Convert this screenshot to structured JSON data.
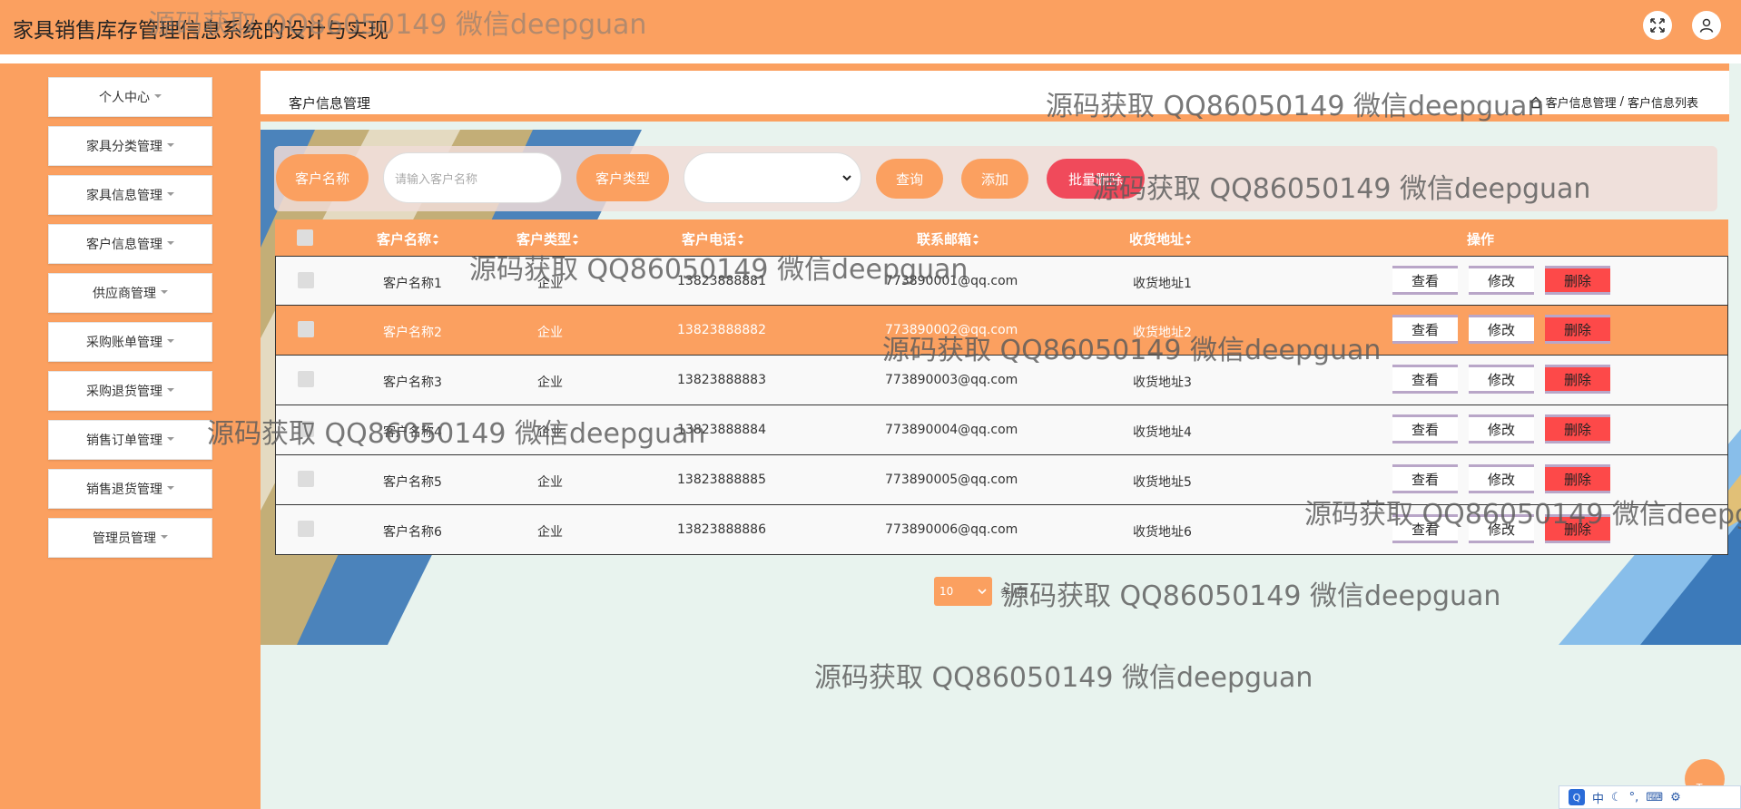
{
  "app": {
    "title": "家具销售库存管理信息系统的设计与实现"
  },
  "sidebar": {
    "items": [
      {
        "label": "个人中心"
      },
      {
        "label": "家具分类管理"
      },
      {
        "label": "家具信息管理"
      },
      {
        "label": "客户信息管理"
      },
      {
        "label": "供应商管理"
      },
      {
        "label": "采购账单管理"
      },
      {
        "label": "采购退货管理"
      },
      {
        "label": "销售订单管理"
      },
      {
        "label": "销售退货管理"
      },
      {
        "label": "管理员管理"
      }
    ]
  },
  "page": {
    "title": "客户信息管理",
    "breadcrumb": [
      "客户信息管理",
      "/",
      "客户信息列表"
    ]
  },
  "search": {
    "name_label": "客户名称",
    "name_placeholder": "请输入客户名称",
    "type_label": "客户类型",
    "type_value": "",
    "query_button": "查询",
    "add_button": "添加",
    "batch_delete_button": "批量删除"
  },
  "table": {
    "columns": [
      "客户名称",
      "客户类型",
      "客户电话",
      "联系邮箱",
      "收货地址",
      "操作"
    ],
    "actions": {
      "view": "查看",
      "edit": "修改",
      "delete": "删除"
    },
    "rows": [
      {
        "name": "客户名称1",
        "type": "企业",
        "phone": "13823888881",
        "email": "773890001@qq.com",
        "address": "收货地址1"
      },
      {
        "name": "客户名称2",
        "type": "企业",
        "phone": "13823888882",
        "email": "773890002@qq.com",
        "address": "收货地址2"
      },
      {
        "name": "客户名称3",
        "type": "企业",
        "phone": "13823888883",
        "email": "773890003@qq.com",
        "address": "收货地址3"
      },
      {
        "name": "客户名称4",
        "type": "企业",
        "phone": "13823888884",
        "email": "773890004@qq.com",
        "address": "收货地址4"
      },
      {
        "name": "客户名称5",
        "type": "企业",
        "phone": "13823888885",
        "email": "773890005@qq.com",
        "address": "收货地址5"
      },
      {
        "name": "客户名称6",
        "type": "企业",
        "phone": "13823888886",
        "email": "773890006@qq.com",
        "address": "收货地址6"
      }
    ]
  },
  "pagination": {
    "page_size": "10",
    "goto_label": "条/页"
  },
  "watermark": {
    "text": "源码获取 QQ86050149 微信deepguan"
  },
  "misc": {
    "top_button": "Top",
    "ime_mode": "中"
  },
  "colors": {
    "accent": "#fba060",
    "danger": "#f04a5b",
    "delete_btn": "#fd4949",
    "background": "#e8f3ee"
  }
}
